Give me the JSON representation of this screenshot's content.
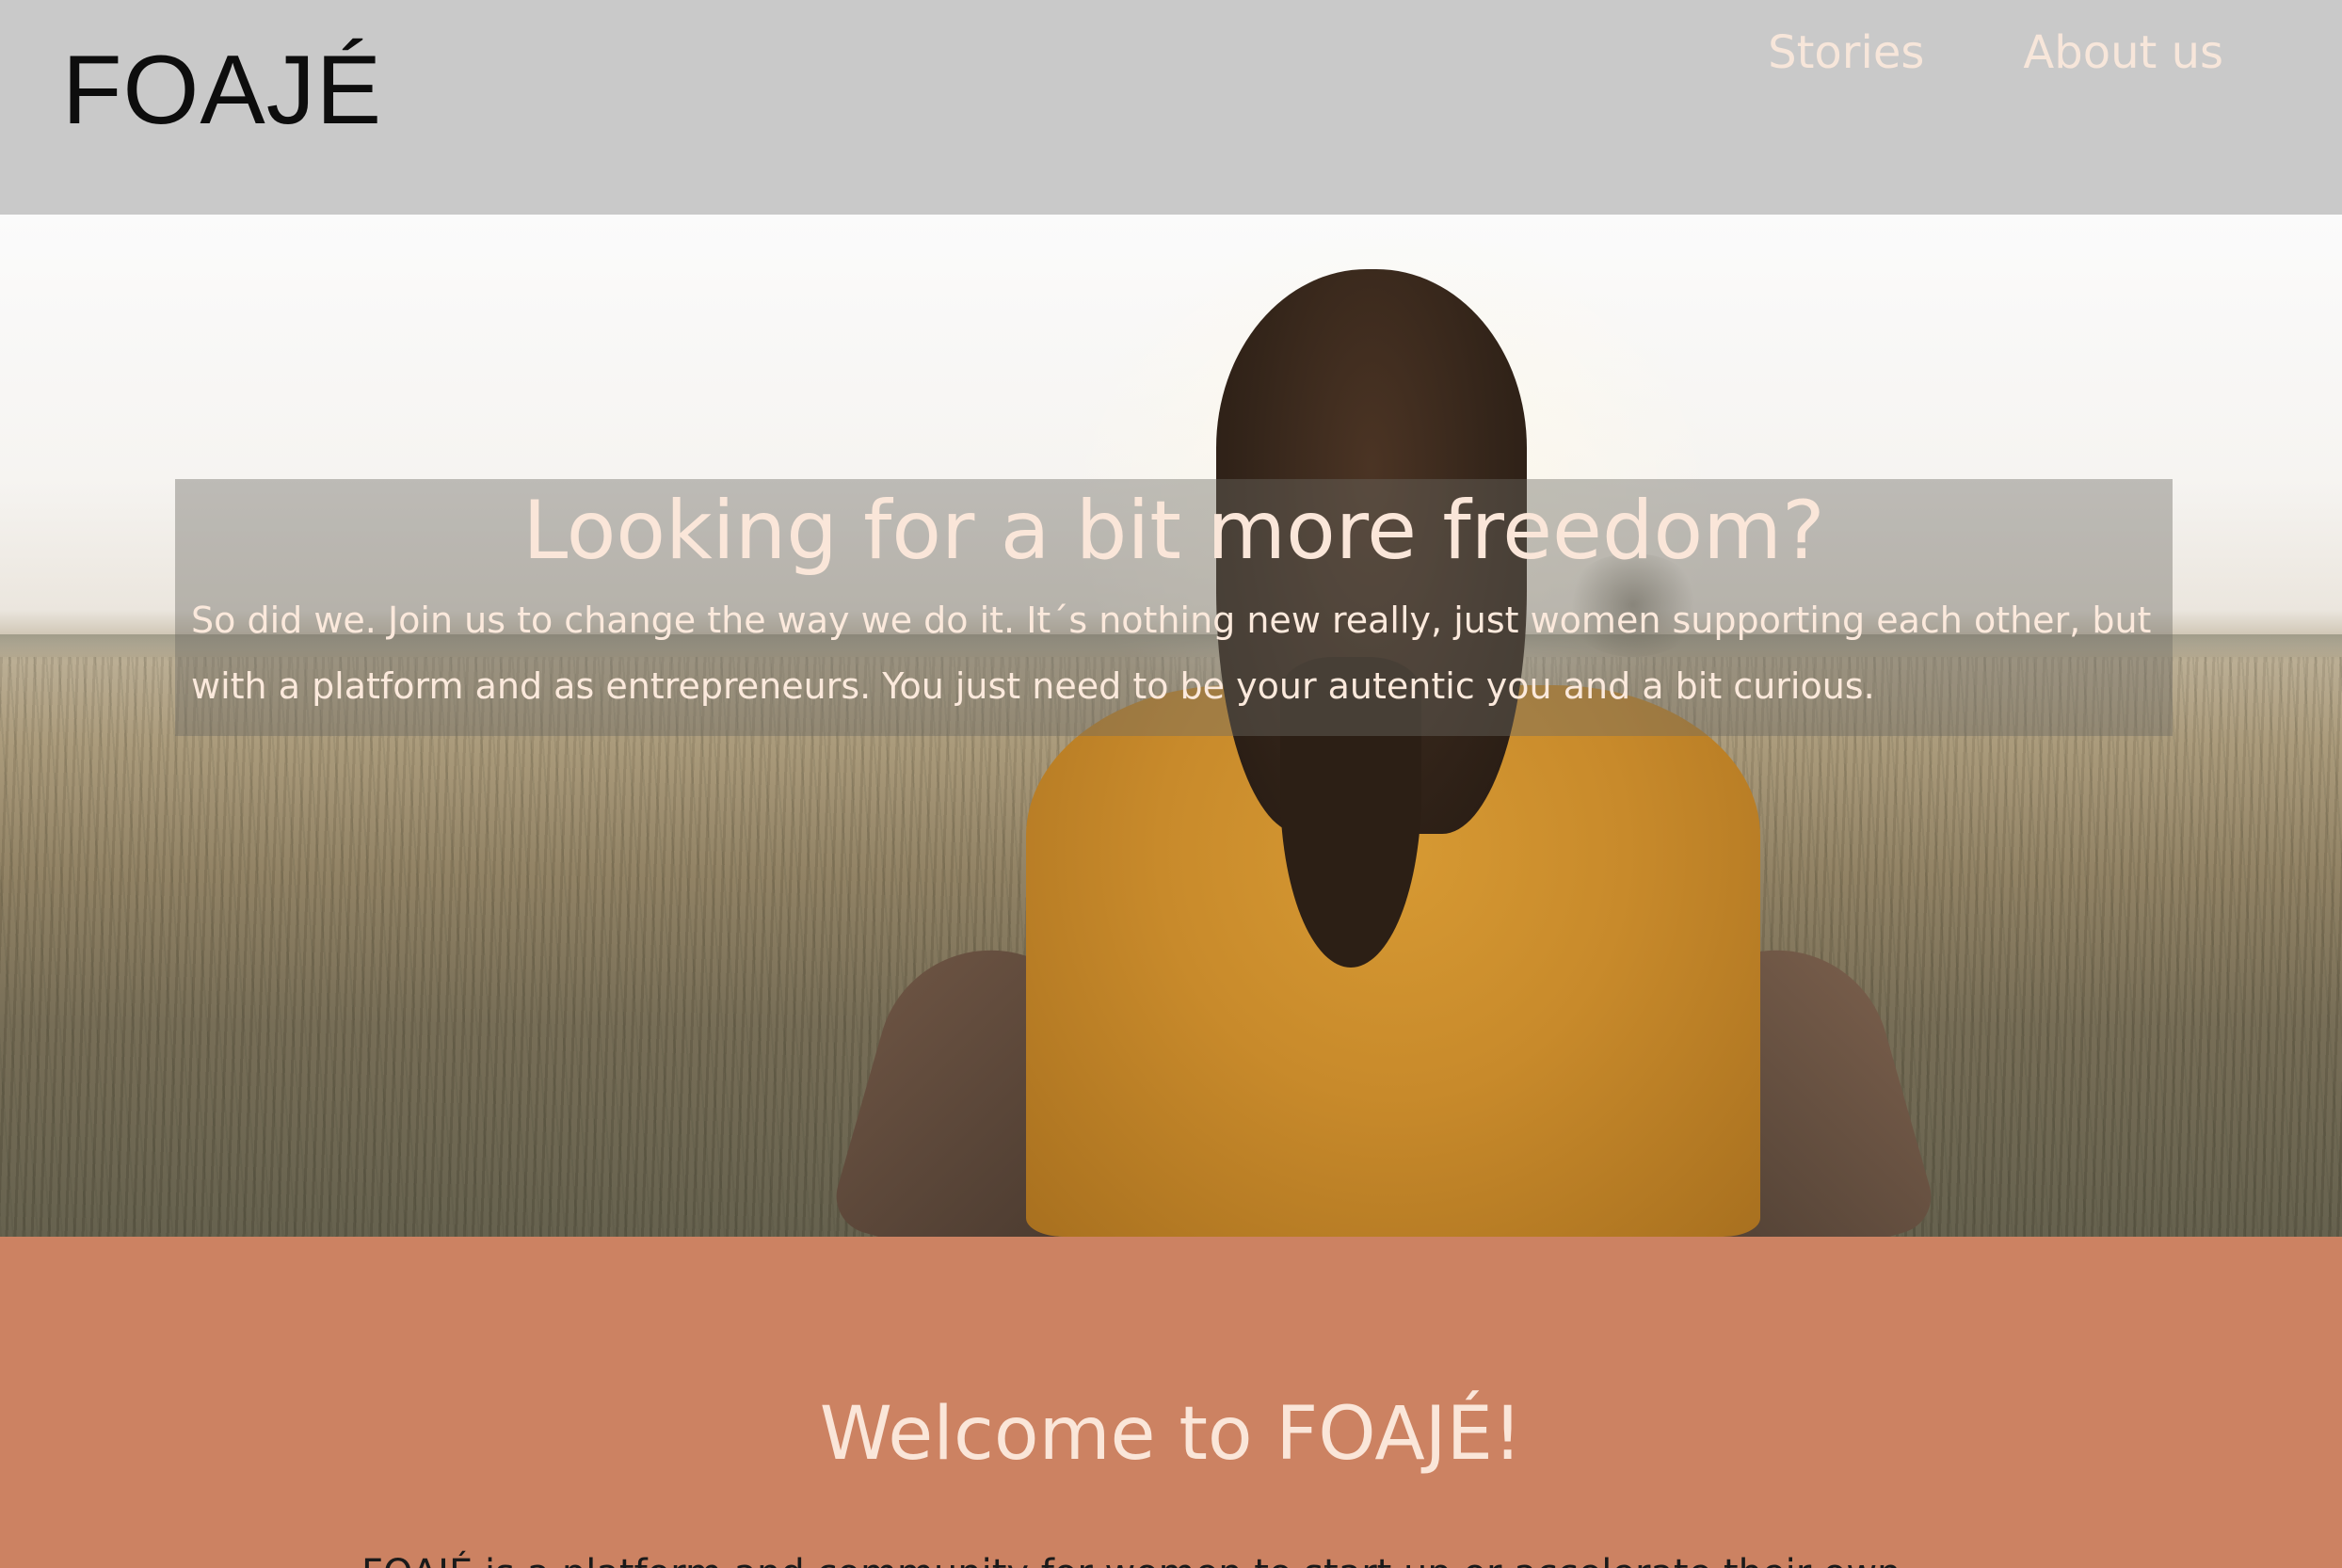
{
  "header": {
    "logo": "FOAJÉ",
    "nav": [
      {
        "label": "Stories"
      },
      {
        "label": "About us"
      }
    ]
  },
  "hero": {
    "title": "Looking for a bit more freedom?",
    "text": "So did we. Join us to change the way we do it. It´s nothing new really, just women supporting each other, but with a platform and as entrepreneurs. You just need to be your autentic you and a bit curious."
  },
  "welcome": {
    "title": "Welcome to FOAJÉ!",
    "text": "FOAJÉ is a platform and community for women to start up or accelerate their own"
  },
  "colors": {
    "header_bg": "#c9c9c9",
    "nav_text": "#f7e6da",
    "hero_text": "#fae6d9",
    "welcome_bg": "#cc8262"
  }
}
